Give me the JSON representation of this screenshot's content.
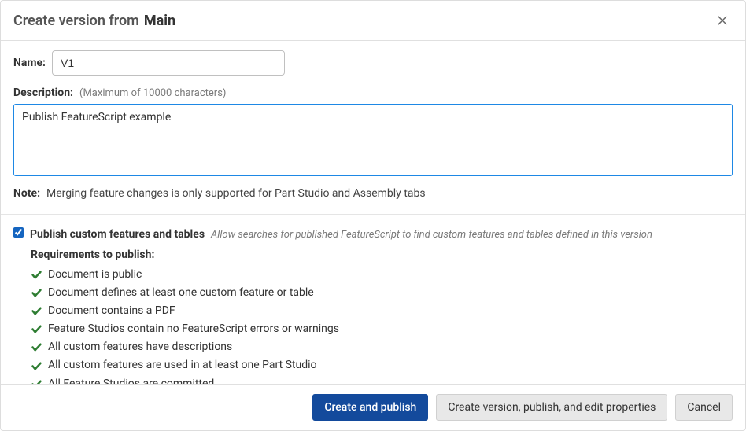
{
  "header": {
    "title_prefix": "Create version from",
    "title_suffix": "Main"
  },
  "form": {
    "name_label": "Name:",
    "name_value": "V1",
    "description_label": "Description:",
    "description_hint": "(Maximum of 10000 characters)",
    "description_value": "Publish FeatureScript example",
    "note_label": "Note:",
    "note_text": "Merging feature changes is only supported for Part Studio and Assembly tabs"
  },
  "publish": {
    "checkbox_label": "Publish custom features and tables",
    "checkbox_hint": "Allow searches for published FeatureScript to find custom features and tables defined in this version",
    "checked": true,
    "requirements_title": "Requirements to publish:",
    "requirements": [
      "Document is public",
      "Document defines at least one custom feature or table",
      "Document contains a PDF",
      "Feature Studios contain no FeatureScript errors or warnings",
      "All custom features have descriptions",
      "All custom features are used in at least one Part Studio",
      "All Feature Studios are committed."
    ]
  },
  "footer": {
    "primary": "Create and publish",
    "secondary": "Create version, publish, and edit properties",
    "cancel": "Cancel"
  }
}
